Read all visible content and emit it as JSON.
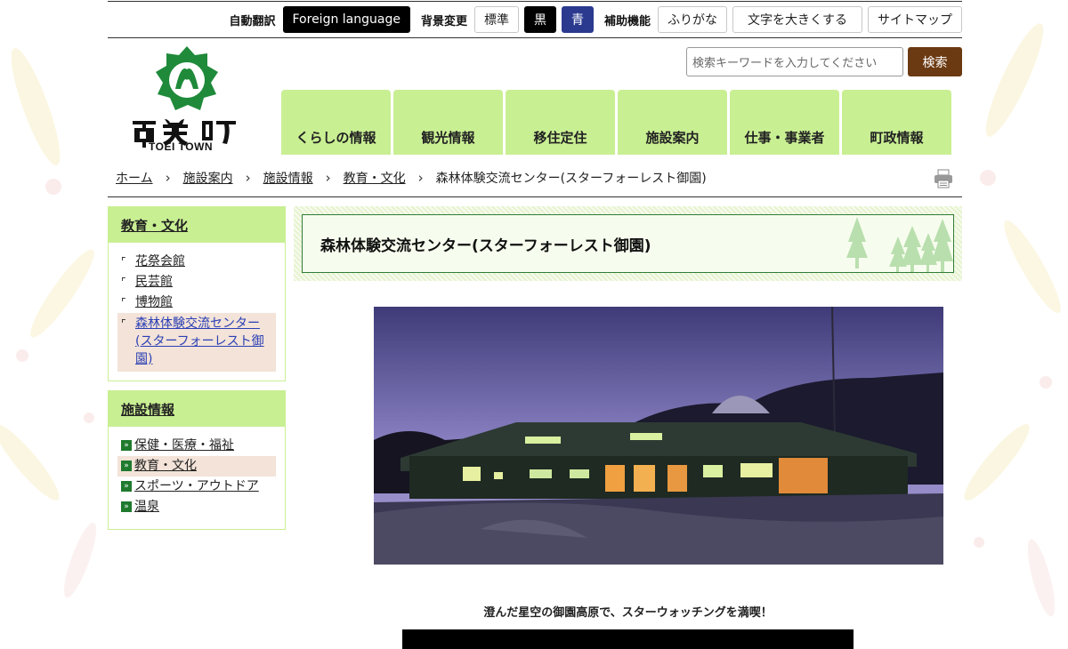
{
  "topbar": {
    "translate_label": "自動翻訳",
    "foreign_language": "Foreign language",
    "bg_label": "背景変更",
    "bg_standard": "標準",
    "bg_black": "黒",
    "bg_blue": "青",
    "assist_label": "補助機能",
    "furigana": "ふりがな",
    "enlarge_text": "文字を大きくする",
    "sitemap": "サイトマップ"
  },
  "logo": {
    "subtitle": "TOEI TOWN"
  },
  "search": {
    "placeholder": "検索キーワードを入力してください",
    "button": "検索"
  },
  "gnav": [
    "くらしの情報",
    "観光情報",
    "移住定住",
    "施設案内",
    "仕事・事業者",
    "町政情報"
  ],
  "breadcrumb": {
    "items": [
      "ホーム",
      "施設案内",
      "施設情報",
      "教育・文化"
    ],
    "current": "森林体験交流センター(スターフォーレスト御園)"
  },
  "sidebar": {
    "box1": {
      "title": "教育・文化",
      "items": [
        "花祭会館",
        "民芸館",
        "博物館",
        "森林体験交流センター(スターフォーレスト御園)"
      ]
    },
    "box2": {
      "title": "施設情報",
      "items": [
        "保健・医療・福祉",
        "教育・文化",
        "スポーツ・アウトドア",
        "温泉"
      ]
    }
  },
  "page": {
    "title": "森林体験交流センター(スターフォーレスト御園)",
    "caption": "澄んだ星空の御園高原で、スターウォッチングを満喫！"
  },
  "colors": {
    "nav_green": "#c9ef93",
    "search_brown": "#6b3a12",
    "active_bg": "#f3e3d8",
    "title_border": "#2f7d37"
  }
}
